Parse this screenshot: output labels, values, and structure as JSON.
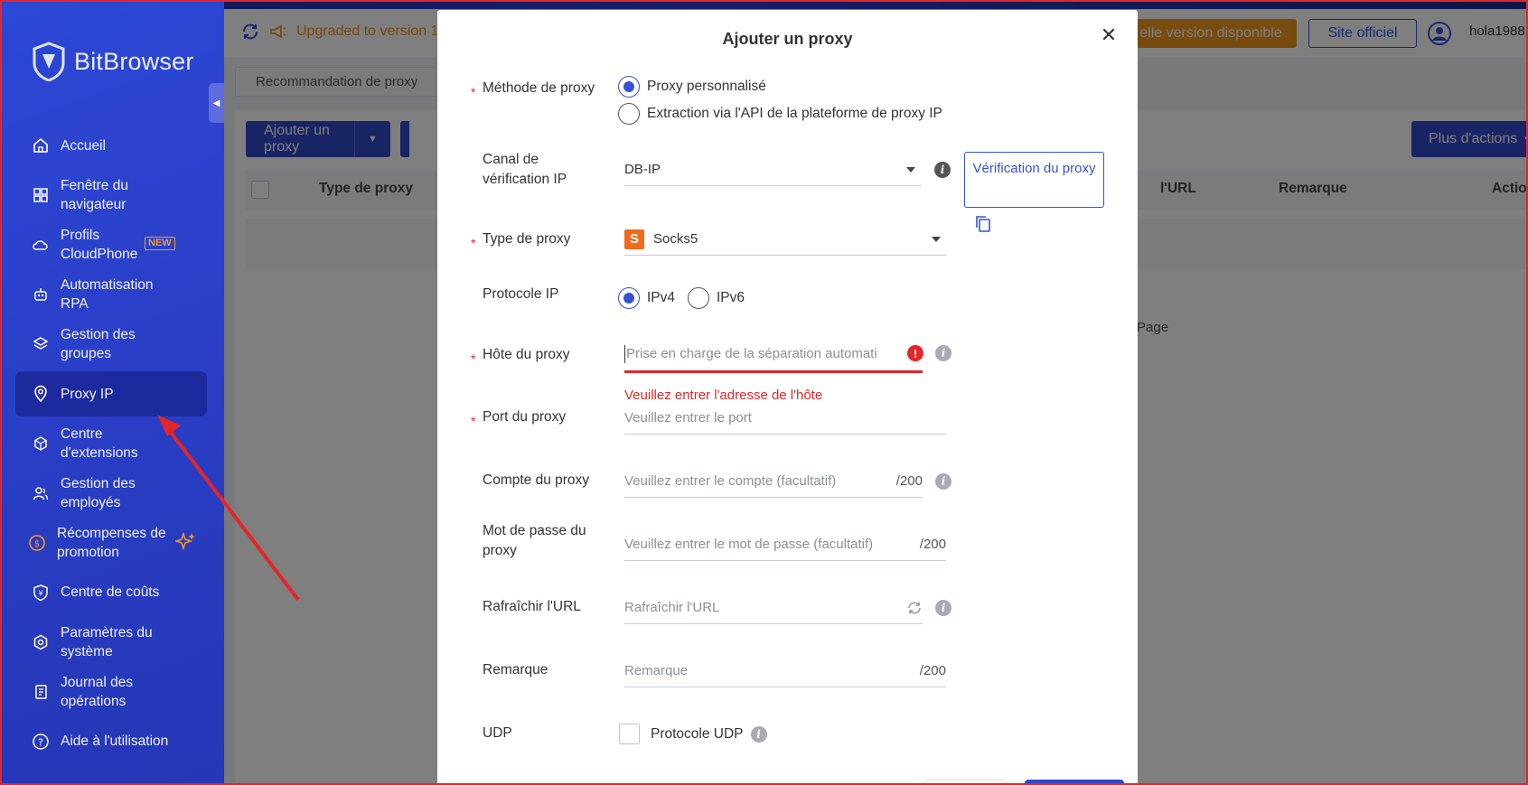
{
  "app": {
    "name": "BitBrowser"
  },
  "sidebar": {
    "items": [
      {
        "label": "Accueil",
        "icon": "home-icon"
      },
      {
        "label": "Fenêtre du navigateur",
        "icon": "grid-icon"
      },
      {
        "label": "Profils CloudPhone",
        "icon": "cloud-icon",
        "badge": "NEW"
      },
      {
        "label": "Automatisation RPA",
        "icon": "robot-icon"
      },
      {
        "label": "Gestion des groupes",
        "icon": "layers-icon"
      },
      {
        "label": "Proxy IP",
        "icon": "location-pin-icon",
        "active": true
      },
      {
        "label": "Centre d'extensions",
        "icon": "cube-icon"
      },
      {
        "label": "Gestion des employés",
        "icon": "users-icon"
      },
      {
        "label": "Récompenses de promotion",
        "icon": "coin-icon"
      },
      {
        "label": "Centre de coûts",
        "icon": "shield-yen-icon"
      },
      {
        "label": "Paramètres du système",
        "icon": "settings-hex-icon"
      },
      {
        "label": "Journal des opérations",
        "icon": "log-icon"
      },
      {
        "label": "Aide à l'utilisation",
        "icon": "help-icon"
      }
    ]
  },
  "topbar": {
    "upgrade_text": "Upgraded to version 1",
    "new_version": "elle version disponible",
    "site": "Site officiel",
    "username": "hola1988"
  },
  "page": {
    "tab": "Recommandation de proxy",
    "add_proxy": "Ajouter un proxy",
    "more_actions": "Plus d'actions",
    "columns": [
      "Type de proxy",
      "l'URL",
      "Remarque",
      "Action"
    ],
    "pager_text": "Page"
  },
  "modal": {
    "title": "Ajouter un proxy",
    "method_label": "Méthode de proxy",
    "method_options": [
      "Proxy personnalisé",
      "Extraction via l'API de la plateforme de proxy IP"
    ],
    "canal_label": "Canal de vérification IP",
    "canal_value": "DB-IP",
    "verify_button": "Vérification du proxy",
    "type_label": "Type de proxy",
    "type_value": "Socks5",
    "type_badge": "S",
    "protocol_label": "Protocole IP",
    "protocol_options": [
      "IPv4",
      "IPv6"
    ],
    "host_label": "Hôte du proxy",
    "host_placeholder": "Prise en charge de la séparation automati",
    "host_error": "Veuillez entrer l'adresse de l'hôte",
    "port_label": "Port du proxy",
    "port_placeholder": "Veuillez entrer le port",
    "account_label": "Compte du proxy",
    "account_placeholder": "Veuillez entrer le compte (facultatif)",
    "account_suffix": "/200",
    "password_label": "Mot de passe du proxy",
    "password_placeholder": "Veuillez entrer le mot de passe (facultatif)",
    "password_suffix": "/200",
    "refresh_label": "Rafraîchir l'URL",
    "refresh_placeholder": "Rafraîchir l'URL",
    "remark_label": "Remarque",
    "remark_placeholder": "Remarque",
    "remark_suffix": "/200",
    "udp_label": "UDP",
    "udp_option": "Protocole UDP"
  },
  "colors": {
    "accent": "#3451d6",
    "sidebar": "#2a3fc8",
    "error": "#e5252a",
    "warning": "#f0961e"
  }
}
